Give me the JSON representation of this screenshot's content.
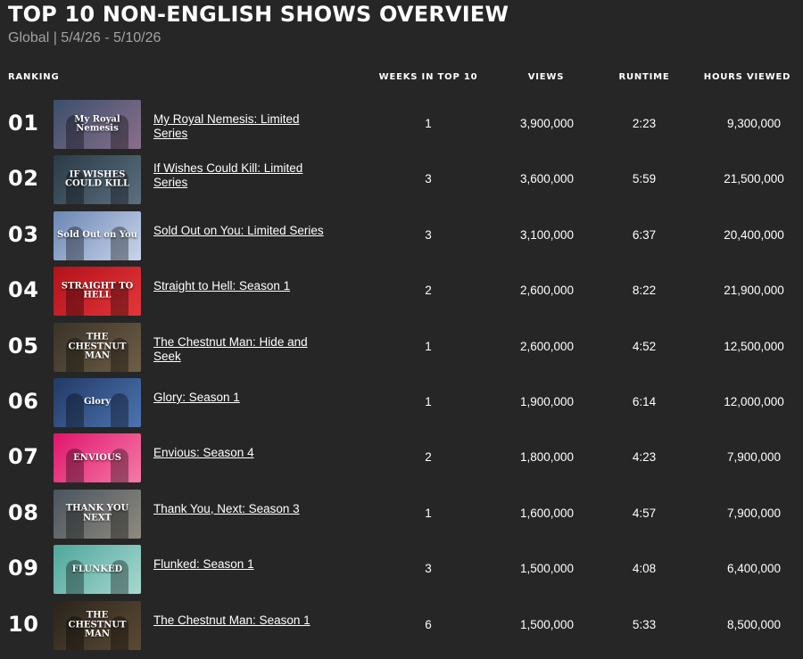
{
  "header": {
    "title": "TOP 10 NON-ENGLISH SHOWS OVERVIEW",
    "subtitle": "Global | 5/4/26 - 5/10/26"
  },
  "columns": {
    "ranking": "RANKING",
    "weeks": "WEEKS IN TOP 10",
    "views": "VIEWS",
    "runtime": "RUNTIME",
    "hours": "HOURS VIEWED"
  },
  "rows": [
    {
      "rank": "01",
      "title": "My Royal Nemesis: Limited Series",
      "weeks": "1",
      "views": "3,900,000",
      "runtime": "2:23",
      "hours": "9,300,000",
      "thumb_text": "My Royal Nemesis",
      "thumb_colors": [
        "#3b4f6b",
        "#8a6f8c"
      ]
    },
    {
      "rank": "02",
      "title": "If Wishes Could Kill: Limited Series",
      "weeks": "3",
      "views": "3,600,000",
      "runtime": "5:59",
      "hours": "21,500,000",
      "thumb_text": "IF WISHES COULD KILL",
      "thumb_colors": [
        "#2b3a46",
        "#5b7080"
      ]
    },
    {
      "rank": "03",
      "title": "Sold Out on You: Limited Series",
      "weeks": "3",
      "views": "3,100,000",
      "runtime": "6:37",
      "hours": "20,400,000",
      "thumb_text": "Sold Out on You",
      "thumb_colors": [
        "#6b86b3",
        "#c9d6ea"
      ]
    },
    {
      "rank": "04",
      "title": "Straight to Hell: Season 1",
      "weeks": "2",
      "views": "2,600,000",
      "runtime": "8:22",
      "hours": "21,900,000",
      "thumb_text": "STRAIGHT TO HELL",
      "thumb_colors": [
        "#b3121a",
        "#e3363a"
      ]
    },
    {
      "rank": "05",
      "title": "The Chestnut Man: Hide and Seek",
      "weeks": "1",
      "views": "2,600,000",
      "runtime": "4:52",
      "hours": "12,500,000",
      "thumb_text": "THE CHESTNUT MAN",
      "thumb_colors": [
        "#3a3328",
        "#6e5e46"
      ]
    },
    {
      "rank": "06",
      "title": "Glory: Season 1",
      "weeks": "1",
      "views": "1,900,000",
      "runtime": "6:14",
      "hours": "12,000,000",
      "thumb_text": "Glory",
      "thumb_colors": [
        "#223a66",
        "#4c74b0"
      ]
    },
    {
      "rank": "07",
      "title": "Envious: Season 4",
      "weeks": "2",
      "views": "1,800,000",
      "runtime": "4:23",
      "hours": "7,900,000",
      "thumb_text": "ENVIOUS",
      "thumb_colors": [
        "#e0156b",
        "#f57aa8"
      ]
    },
    {
      "rank": "08",
      "title": "Thank You, Next: Season 3",
      "weeks": "1",
      "views": "1,600,000",
      "runtime": "4:57",
      "hours": "7,900,000",
      "thumb_text": "THANK YOU NEXT",
      "thumb_colors": [
        "#4a5560",
        "#8f8a7e"
      ]
    },
    {
      "rank": "09",
      "title": "Flunked: Season 1",
      "weeks": "3",
      "views": "1,500,000",
      "runtime": "4:08",
      "hours": "6,400,000",
      "thumb_text": "FLUNKED",
      "thumb_colors": [
        "#4ea79c",
        "#a8d8cf"
      ]
    },
    {
      "rank": "10",
      "title": "The Chestnut Man: Season 1",
      "weeks": "6",
      "views": "1,500,000",
      "runtime": "5:33",
      "hours": "8,500,000",
      "thumb_text": "THE CHESTNUT MAN",
      "thumb_colors": [
        "#2b241c",
        "#5a4a34"
      ]
    }
  ]
}
